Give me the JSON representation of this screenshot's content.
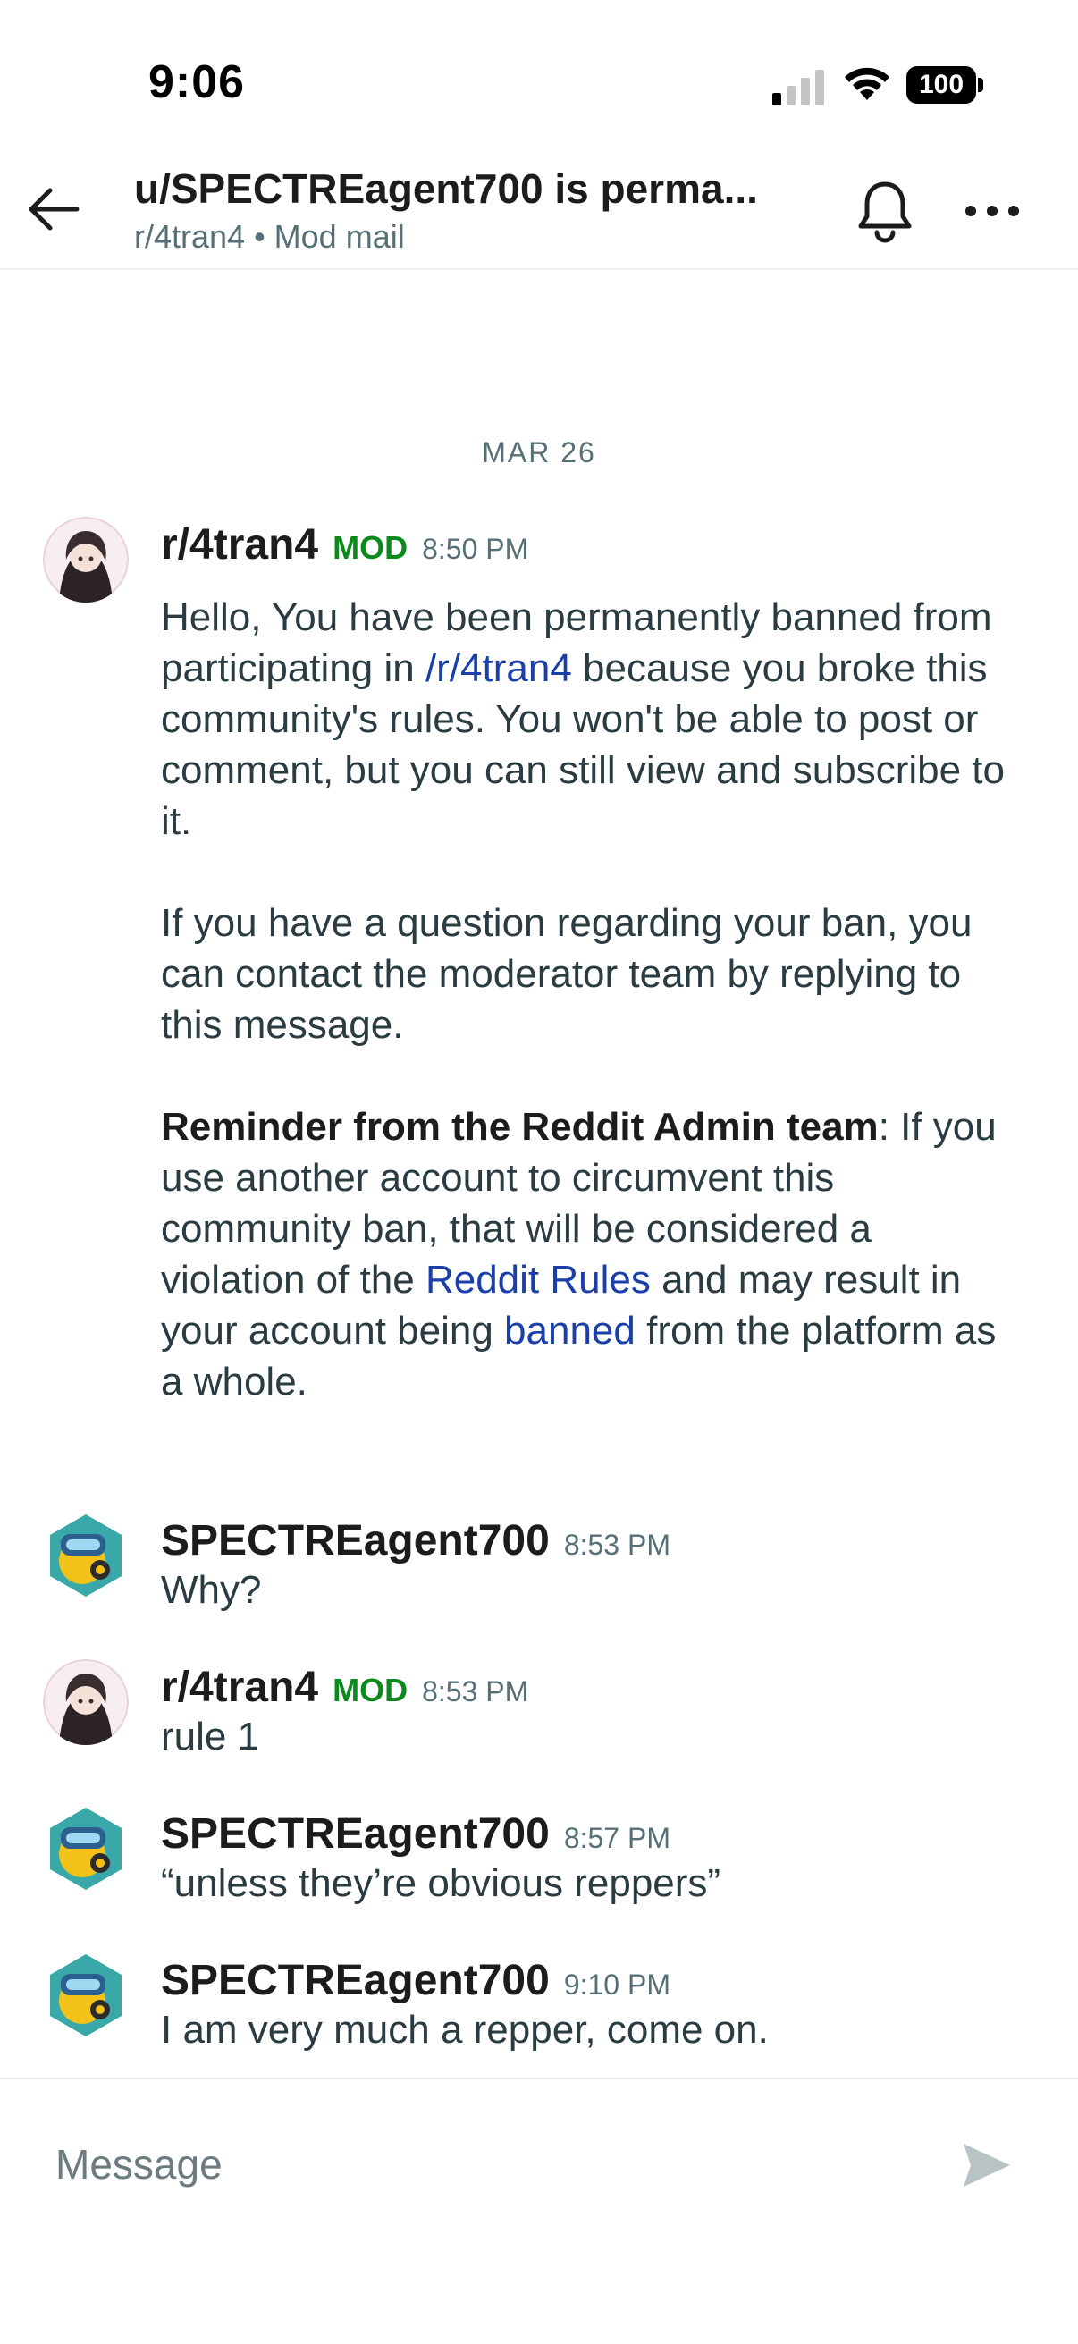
{
  "status_bar": {
    "time": "9:06",
    "battery": "100"
  },
  "header": {
    "title": "u/SPECTREagent700 is perma...",
    "subtitle": "r/4tran4 • Mod mail"
  },
  "date_separator": "MAR 26",
  "messages": [
    {
      "author": "r/4tran4",
      "badge": "MOD",
      "time": "8:50 PM",
      "paragraphs": {
        "p1_a": "Hello, You have been permanently banned from participating in ",
        "p1_link": "/r/4tran4",
        "p1_b": " because you broke this community's rules. You won't be able to post or comment, but you can still view and subscribe to it.",
        "p2": "If you have a question regarding your ban, you can contact the moderator team by replying to this message.",
        "p3_bold": "Reminder from the Reddit Admin team",
        "p3_a": ": If you use another account to circumvent this community ban, that will be considered a violation of the ",
        "p3_link1": "Reddit Rules",
        "p3_b": " and may result in your account being ",
        "p3_link2": "banned",
        "p3_c": " from the platform as a whole."
      }
    },
    {
      "author": "SPECTREagent700",
      "time": "8:53 PM",
      "text": "Why?"
    },
    {
      "author": "r/4tran4",
      "badge": "MOD",
      "time": "8:53 PM",
      "text": "rule 1"
    },
    {
      "author": "SPECTREagent700",
      "time": "8:57 PM",
      "text": "“unless they’re obvious reppers”"
    },
    {
      "author": "SPECTREagent700",
      "time": "9:10 PM",
      "text": "I am very much a repper, come on."
    }
  ],
  "composer": {
    "placeholder": "Message"
  },
  "icons": {
    "back": "arrow-left-icon",
    "bell": "bell-icon",
    "more": "more-dots-icon",
    "send": "send-icon",
    "signal": "cellular-signal-icon",
    "wifi": "wifi-icon",
    "battery": "battery-icon"
  },
  "colors": {
    "mod_badge": "#0a8a1a",
    "link": "#1a3fa8",
    "muted": "#576f76"
  }
}
